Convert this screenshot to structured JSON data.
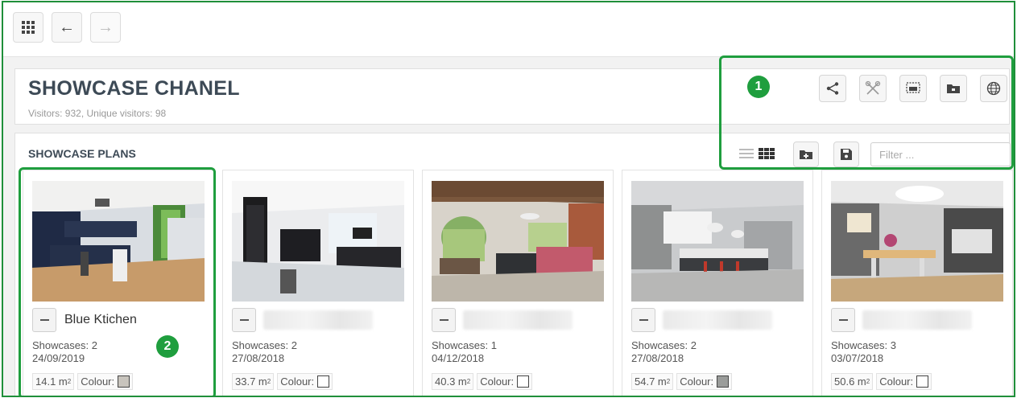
{
  "page": {
    "title": "SHOWCASE CHANEL",
    "stats": "Visitors: 932, Unique visitors: 98"
  },
  "toolbar": {
    "back_arrow": "←",
    "forward_arrow": "→",
    "icons": [
      "apps-grid-icon",
      "back-arrow-icon",
      "forward-arrow-icon",
      "share-icon",
      "tools-icon",
      "presentation-icon",
      "folder-icon",
      "globe-icon"
    ]
  },
  "plans": {
    "title": "SHOWCASE PLANS",
    "filter_placeholder": "Filter ...",
    "icons": [
      "list-view-icon",
      "grid-view-icon",
      "add-folder-icon",
      "save-icon"
    ],
    "cards": [
      {
        "name": "Blue Ktichen",
        "showcases": "Showcases: 2",
        "date": "24/09/2019",
        "area": "14.1 m",
        "area_unit_sup": "2",
        "colour_label": "Colour:",
        "colour": "#c8c4bd"
      },
      {
        "name": "",
        "showcases": "Showcases: 2",
        "date": "27/08/2018",
        "area": "33.7 m",
        "area_unit_sup": "2",
        "colour_label": "Colour:",
        "colour": "#ffffff"
      },
      {
        "name": "",
        "showcases": "Showcases: 1",
        "date": "04/12/2018",
        "area": "40.3 m",
        "area_unit_sup": "2",
        "colour_label": "Colour:",
        "colour": "#ffffff"
      },
      {
        "name": "",
        "showcases": "Showcases: 2",
        "date": "27/08/2018",
        "area": "54.7 m",
        "area_unit_sup": "2",
        "colour_label": "Colour:",
        "colour": "#9a9c9a"
      },
      {
        "name": "",
        "showcases": "Showcases: 3",
        "date": "03/07/2018",
        "area": "50.6 m",
        "area_unit_sup": "2",
        "colour_label": "Colour:",
        "colour": "#ffffff"
      }
    ]
  },
  "annotations": {
    "marker_1": "1",
    "marker_2": "2"
  },
  "colors": {
    "highlight_green": "#1f9e3e",
    "title_text": "#3d4a56"
  }
}
